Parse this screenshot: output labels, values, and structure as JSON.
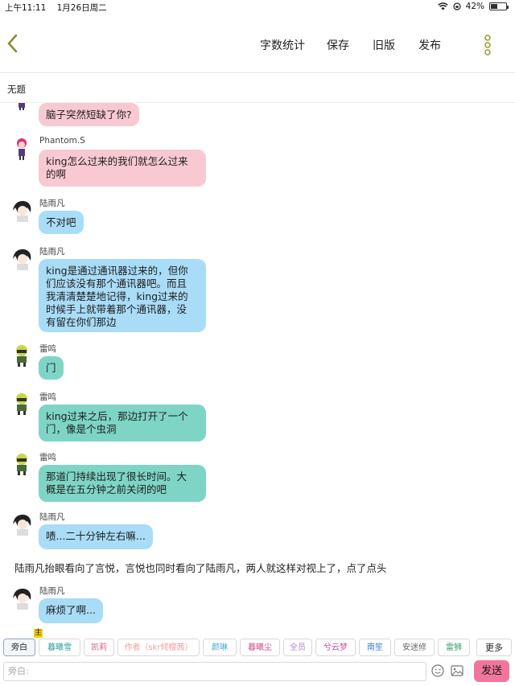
{
  "status_bar": {
    "time": "上午11:11",
    "date": "1月26日周二",
    "battery": "42%",
    "battery_level": 0.42
  },
  "toolbar": {
    "word_count": "字数统计",
    "save": "保存",
    "old_version": "旧版",
    "publish": "发布"
  },
  "doc": {
    "title": "无题"
  },
  "messages": [
    {
      "sender": "",
      "text": "脑子突然短缺了你?",
      "color": "#f9c9d3"
    },
    {
      "sender": "Phantom.S",
      "lines": [
        "king怎么过来的我们就怎么过来",
        "的啊"
      ],
      "color": "#f9c9d3"
    },
    {
      "sender": "陆雨凡",
      "text": "不对吧",
      "color": "#a9dcf7"
    },
    {
      "sender": "陆雨凡",
      "lines": [
        "king是通过通讯器过来的，但你",
        "们应该没有那个通讯器吧。而且",
        "我清清楚楚地记得，king过来的",
        "时候手上就带着那个通讯器，没",
        "有留在你们那边"
      ],
      "color": "#a9dcf7"
    },
    {
      "sender": "雷鸣",
      "text": "门",
      "color": "#7ed5c6"
    },
    {
      "sender": "雷鸣",
      "lines": [
        "king过来之后，那边打开了一个",
        "门，像是个虫洞"
      ],
      "color": "#7ed5c6"
    },
    {
      "sender": "雷鸣",
      "lines": [
        "那道门持续出现了很长时间。大",
        "概是在五分钟之前关闭的吧"
      ],
      "color": "#7ed5c6"
    },
    {
      "sender": "陆雨凡",
      "text": "啧...二十分钟左右嘛...",
      "color": "#a9dcf7"
    },
    {
      "narration": "陆雨凡抬眼看向了言悦，言悦也同时看向了陆雨凡，两人就这样对视上了，点了点头"
    },
    {
      "sender": "陆雨凡",
      "text": "麻烦了啊...",
      "color": "#a9dcf7"
    }
  ],
  "roles": [
    {
      "label": "旁白",
      "color": "#222222",
      "active": true
    },
    {
      "label": "暮曦雪",
      "color": "#2aa198",
      "badge": "主"
    },
    {
      "label": "凯莉",
      "color": "#e0608a"
    },
    {
      "label": "作者（skr倾樱茜）",
      "color": "#f0a0a0"
    },
    {
      "label": "颜琳",
      "color": "#4aa8d8"
    },
    {
      "label": "暮曦尘",
      "color": "#d04a8a"
    },
    {
      "label": "全员",
      "color": "#b080d0"
    },
    {
      "label": "兮云梦",
      "color": "#c050a0"
    },
    {
      "label": "南笙",
      "color": "#3a7bd5"
    },
    {
      "label": "安迷修",
      "color": "#666666"
    },
    {
      "label": "雷狮",
      "color": "#3aa070"
    },
    {
      "label": "更多",
      "color": "#222222"
    }
  ],
  "input": {
    "placeholder": "旁白:",
    "send": "发送"
  }
}
